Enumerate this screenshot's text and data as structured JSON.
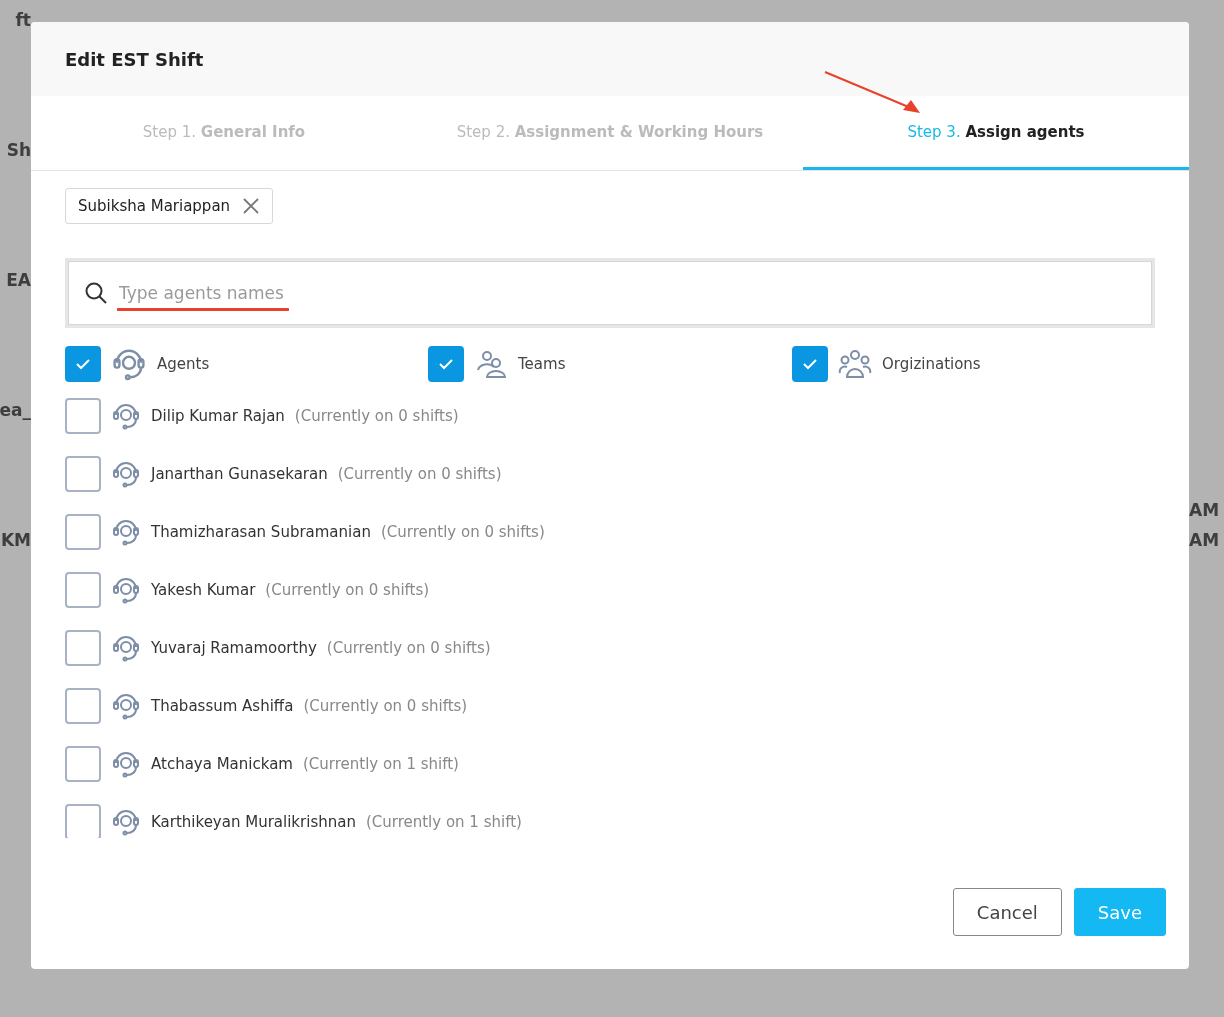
{
  "background": {
    "left_fragments": [
      "ft",
      "Sh",
      "EA",
      "ea_",
      "KM"
    ],
    "right_fragments": [
      "AM",
      "AM"
    ]
  },
  "dialog": {
    "title": "Edit EST Shift",
    "steps": [
      {
        "prefix": "Step 1.",
        "label": "General Info",
        "selected": false
      },
      {
        "prefix": "Step 2.",
        "label": "Assignment & Working Hours",
        "selected": false
      },
      {
        "prefix": "Step 3.",
        "label": "Assign agents",
        "selected": true
      }
    ],
    "chips": [
      "Subiksha Mariappan"
    ],
    "search": {
      "placeholder": "Type agents names"
    },
    "filters": [
      {
        "kind": "agent",
        "label": "Agents",
        "checked": true
      },
      {
        "kind": "team",
        "label": "Teams",
        "checked": true
      },
      {
        "kind": "org",
        "label": "Orgizinations",
        "checked": true
      }
    ],
    "agents": [
      {
        "name": "Dilip Kumar Rajan",
        "note": "(Currently on 0 shifts)",
        "checked": false
      },
      {
        "name": "Janarthan Gunasekaran",
        "note": "(Currently on 0 shifts)",
        "checked": false
      },
      {
        "name": "Thamizharasan Subramanian",
        "note": "(Currently on 0 shifts)",
        "checked": false
      },
      {
        "name": "Yakesh Kumar",
        "note": "(Currently on 0 shifts)",
        "checked": false
      },
      {
        "name": "Yuvaraj Ramamoorthy",
        "note": "(Currently on 0 shifts)",
        "checked": false
      },
      {
        "name": "Thabassum Ashiffa",
        "note": "(Currently on 0 shifts)",
        "checked": false
      },
      {
        "name": "Atchaya Manickam",
        "note": "(Currently on 1 shift)",
        "checked": false
      },
      {
        "name": "Karthikeyan Muralikrishnan",
        "note": "(Currently on 1 shift)",
        "checked": false
      }
    ],
    "buttons": [
      {
        "kind": "secondary",
        "label": "Cancel"
      },
      {
        "kind": "primary",
        "label": "Save"
      }
    ]
  }
}
